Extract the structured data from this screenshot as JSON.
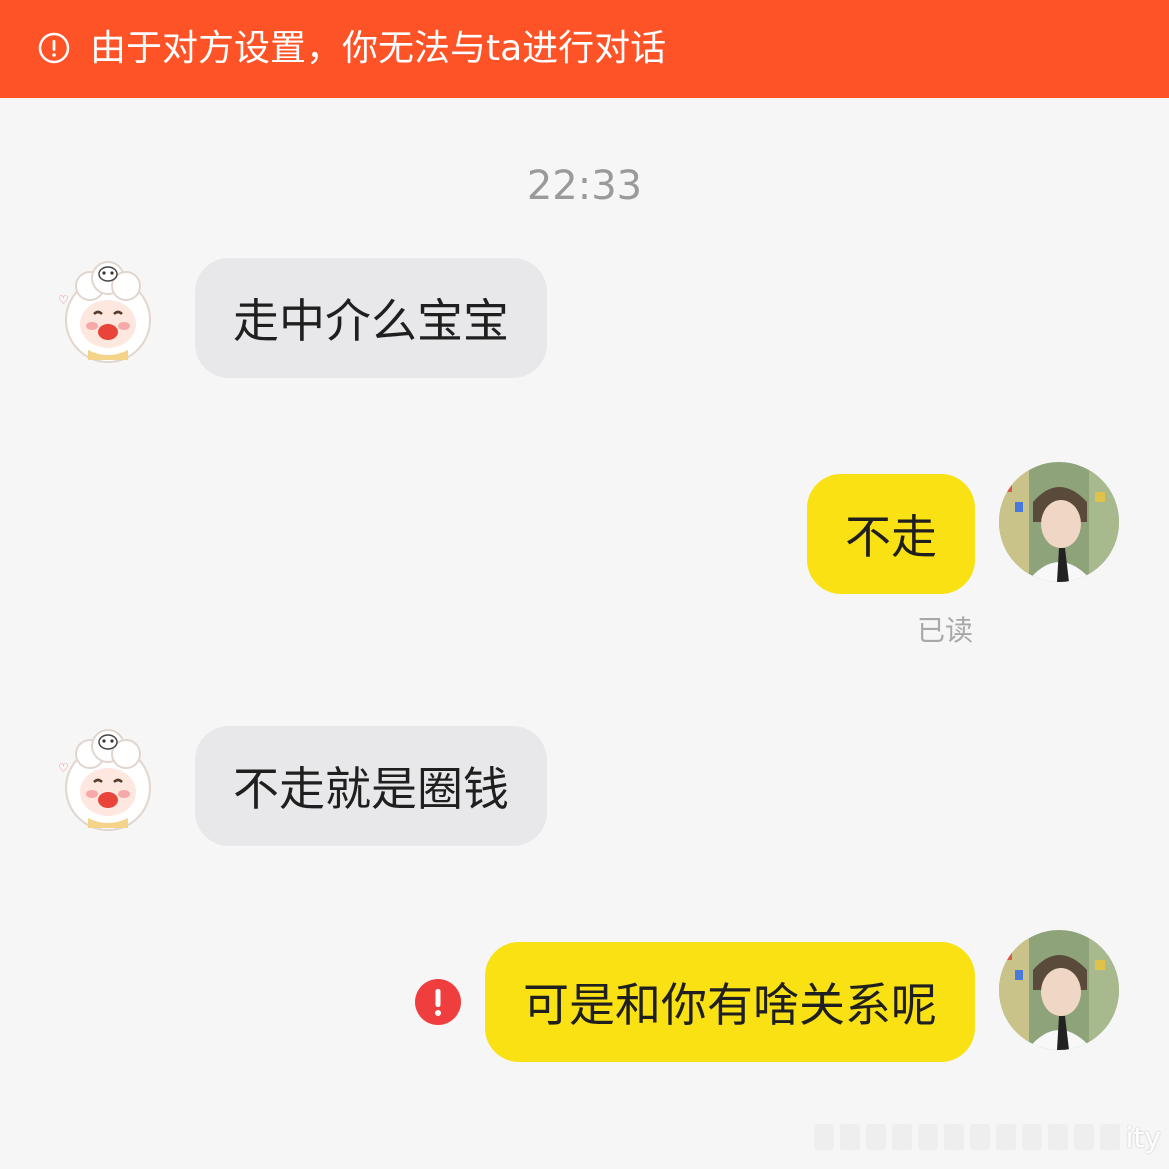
{
  "banner": {
    "text": "由于对方设置，你无法与ta进行对话",
    "icon": "exclamation-circle-icon",
    "color": "#fe5227"
  },
  "timestamp": "22:33",
  "messages": [
    {
      "side": "incoming",
      "text": "走中介么宝宝"
    },
    {
      "side": "outgoing",
      "text": "不走",
      "status": "已读"
    },
    {
      "side": "incoming",
      "text": "不走就是圈钱"
    },
    {
      "side": "outgoing",
      "text": "可是和你有啥关系呢",
      "error": true
    }
  ],
  "colors": {
    "outgoing_bubble": "#f9e113",
    "incoming_bubble": "#e8e8ea",
    "error": "#f03e3e",
    "background": "#f6f6f6"
  },
  "watermark": {
    "suffix": "ity"
  }
}
